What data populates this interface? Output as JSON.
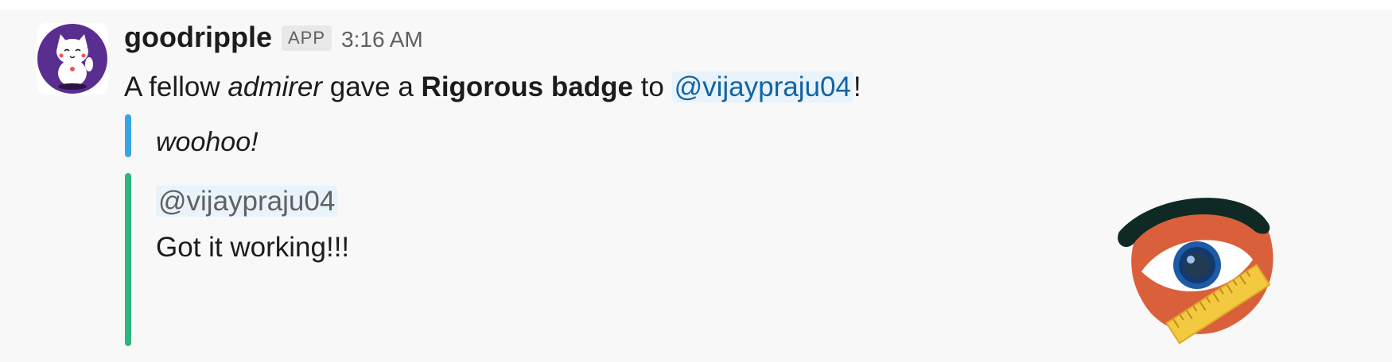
{
  "message": {
    "sender": "goodripple",
    "app_badge": "APP",
    "time": "3:16 AM",
    "text": {
      "part1": "A fellow ",
      "emphasis": "admirer",
      "part2": " gave a ",
      "strong": "Rigorous badge",
      "part3": " to ",
      "mention": "@vijaypraju04",
      "part4": "!"
    }
  },
  "attachments": [
    {
      "bar_color": "#3aa3e3",
      "text": "woohoo!"
    },
    {
      "bar_color": "#2eb67d",
      "mention": "@vijaypraju04",
      "text": "Got it working!!!",
      "image": "eye-with-ruler-badge"
    }
  ],
  "icons": {
    "avatar": "lucky-cat-avatar",
    "badge": "eye-ruler-icon"
  },
  "colors": {
    "avatar_bg": "#5a2d91",
    "mention": "#1264a3",
    "badge_face": "#d9603b",
    "brow": "#0f2a24",
    "iris": "#1d5aa8",
    "ruler": "#f3c93f"
  }
}
